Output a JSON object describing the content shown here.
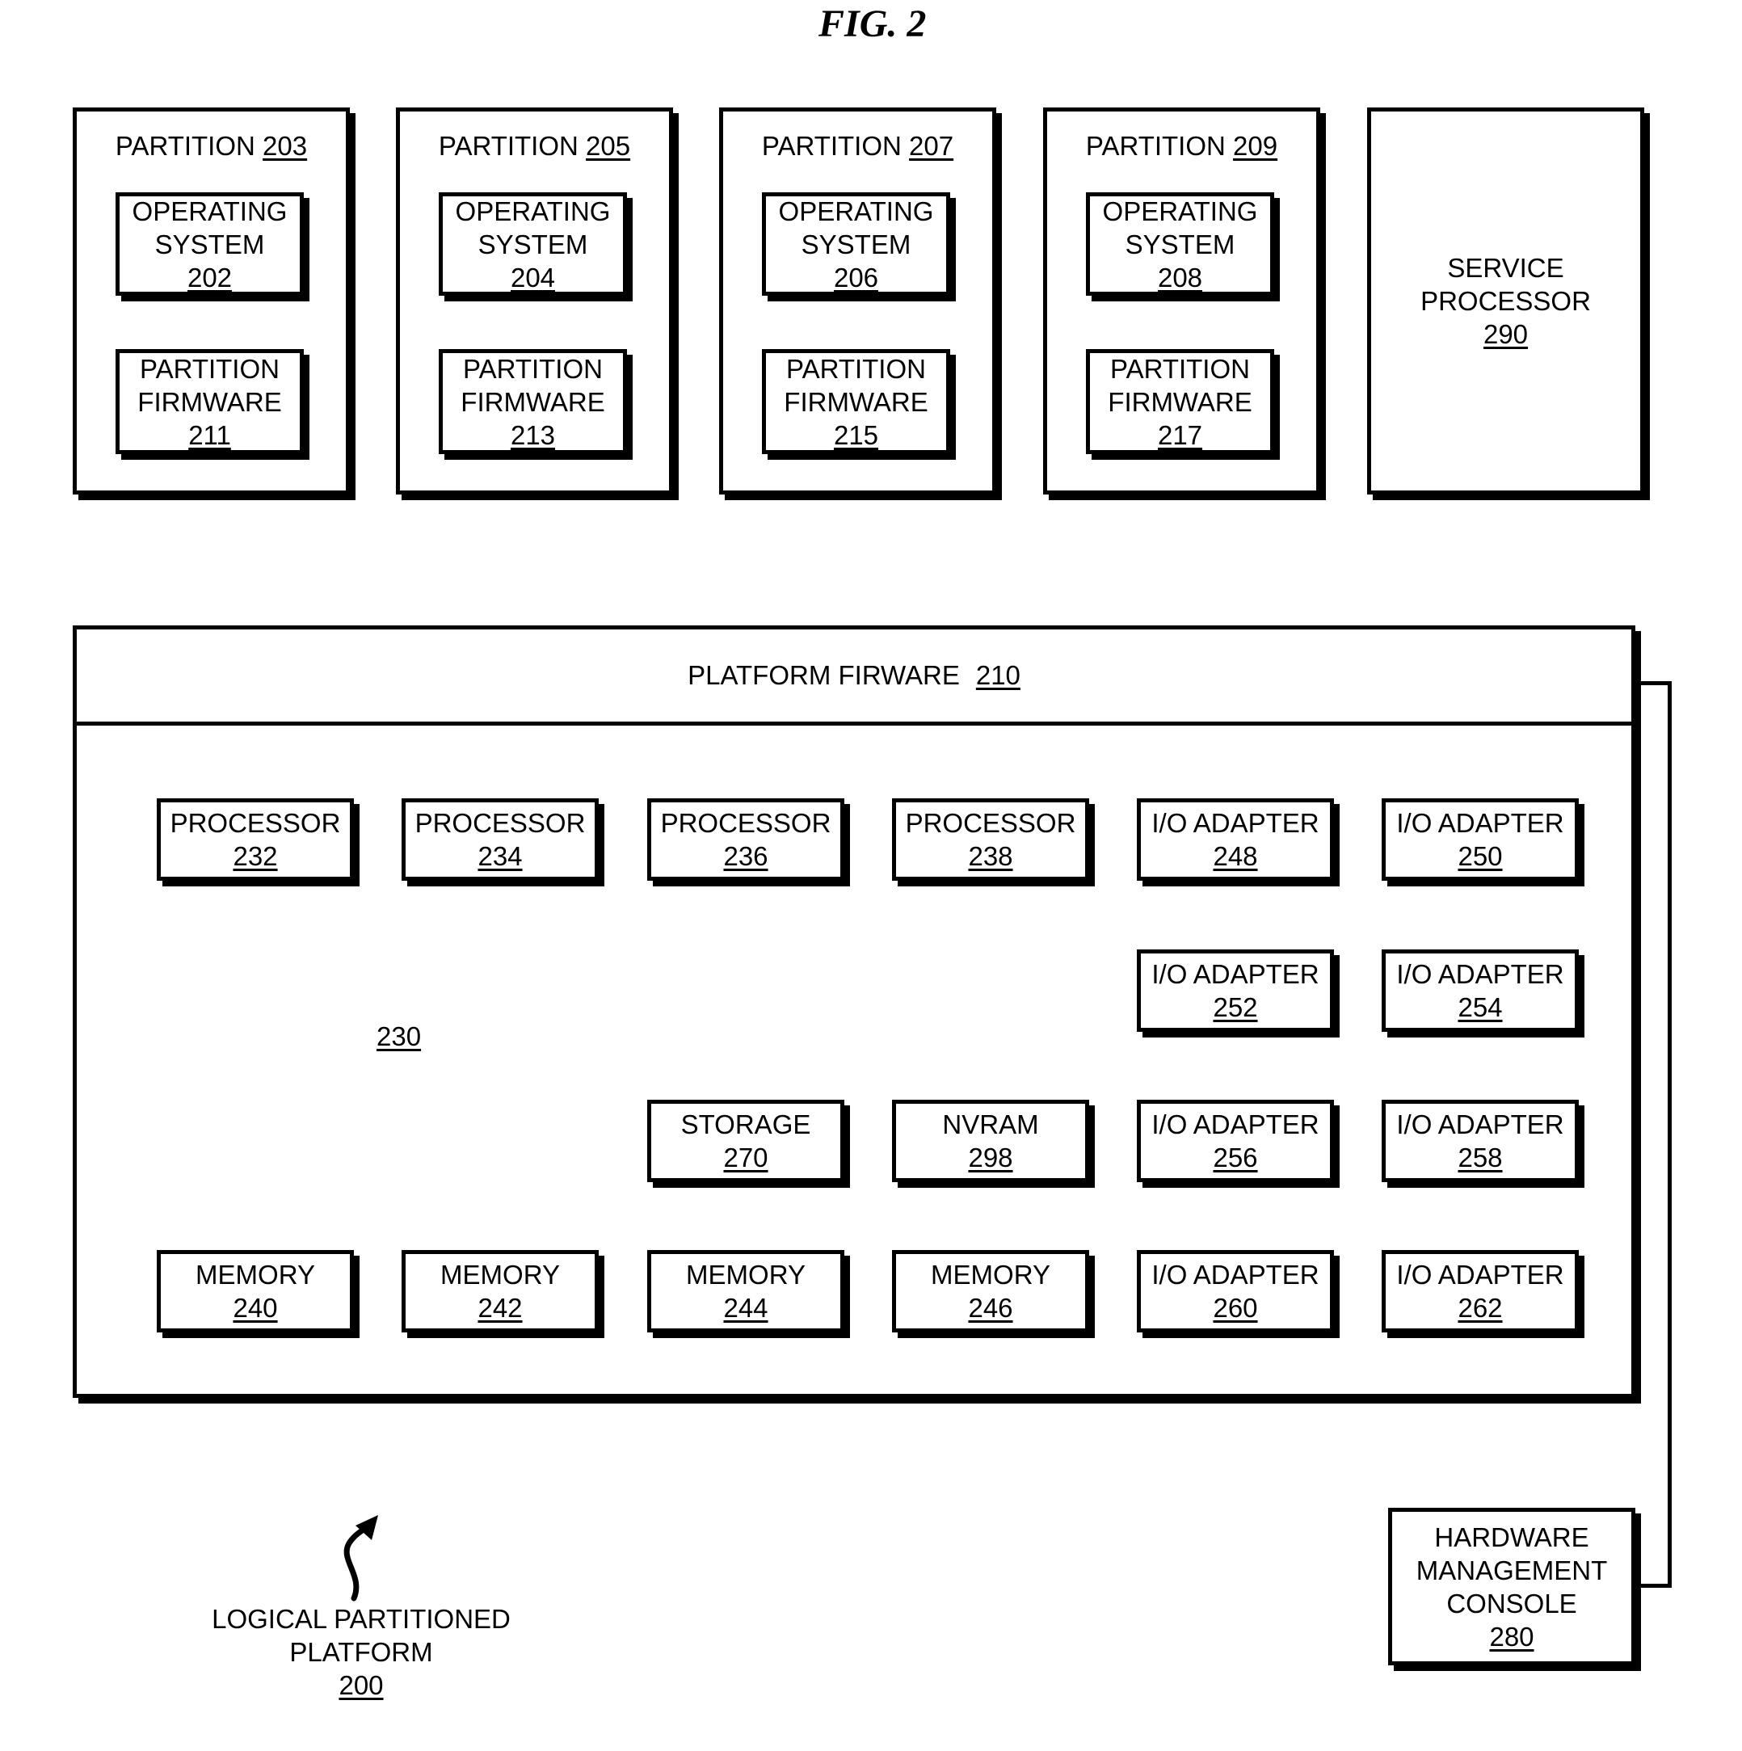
{
  "figure_title": "FIG. 2",
  "partitions": [
    {
      "label": "PARTITION",
      "num": "203",
      "os": {
        "l1": "OPERATING",
        "l2": "SYSTEM",
        "num": "202"
      },
      "fw": {
        "l1": "PARTITION",
        "l2": "FIRMWARE",
        "num": "211"
      }
    },
    {
      "label": "PARTITION",
      "num": "205",
      "os": {
        "l1": "OPERATING",
        "l2": "SYSTEM",
        "num": "204"
      },
      "fw": {
        "l1": "PARTITION",
        "l2": "FIRMWARE",
        "num": "213"
      }
    },
    {
      "label": "PARTITION",
      "num": "207",
      "os": {
        "l1": "OPERATING",
        "l2": "SYSTEM",
        "num": "206"
      },
      "fw": {
        "l1": "PARTITION",
        "l2": "FIRMWARE",
        "num": "215"
      }
    },
    {
      "label": "PARTITION",
      "num": "209",
      "os": {
        "l1": "OPERATING",
        "l2": "SYSTEM",
        "num": "208"
      },
      "fw": {
        "l1": "PARTITION",
        "l2": "FIRMWARE",
        "num": "217"
      }
    }
  ],
  "service_processor": {
    "l1": "SERVICE",
    "l2": "PROCESSOR",
    "num": "290"
  },
  "platform_firmware": {
    "label": "PLATFORM FIRWARE",
    "num": "210"
  },
  "hardware_label": "230",
  "components": [
    {
      "name": "PROCESSOR",
      "num": "232"
    },
    {
      "name": "PROCESSOR",
      "num": "234"
    },
    {
      "name": "PROCESSOR",
      "num": "236"
    },
    {
      "name": "PROCESSOR",
      "num": "238"
    },
    {
      "name": "I/O ADAPTER",
      "num": "248"
    },
    {
      "name": "I/O ADAPTER",
      "num": "250"
    },
    {
      "name": "I/O ADAPTER",
      "num": "252"
    },
    {
      "name": "I/O ADAPTER",
      "num": "254"
    },
    {
      "name": "STORAGE",
      "num": "270"
    },
    {
      "name": "NVRAM",
      "num": "298"
    },
    {
      "name": "I/O ADAPTER",
      "num": "256"
    },
    {
      "name": "I/O ADAPTER",
      "num": "258"
    },
    {
      "name": "MEMORY",
      "num": "240"
    },
    {
      "name": "MEMORY",
      "num": "242"
    },
    {
      "name": "MEMORY",
      "num": "244"
    },
    {
      "name": "MEMORY",
      "num": "246"
    },
    {
      "name": "I/O ADAPTER",
      "num": "260"
    },
    {
      "name": "I/O ADAPTER",
      "num": "262"
    }
  ],
  "hmc": {
    "l1": "HARDWARE",
    "l2": "MANAGEMENT",
    "l3": "CONSOLE",
    "num": "280"
  },
  "platform_caption": {
    "l1": "LOGICAL PARTITIONED",
    "l2": "PLATFORM",
    "num": "200"
  }
}
